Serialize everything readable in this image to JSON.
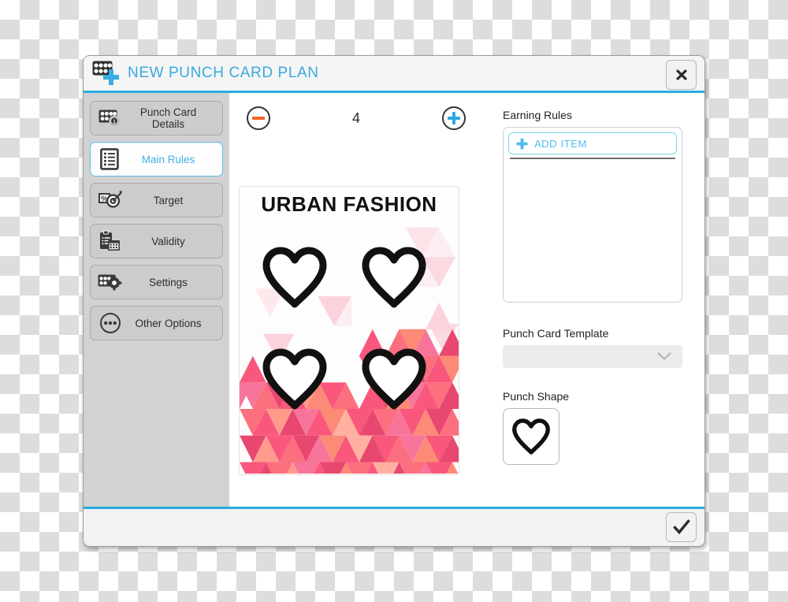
{
  "window": {
    "title": "NEW PUNCH CARD PLAN",
    "title_icon": "punch-card-plus-icon",
    "close_icon": "close-icon",
    "accent_color": "#29abe2"
  },
  "sidebar": {
    "items": [
      {
        "label": "Punch Card Details",
        "icon": "punch-card-info-icon",
        "active": false
      },
      {
        "label": "Main Rules",
        "icon": "list-document-icon",
        "active": true
      },
      {
        "label": "Target",
        "icon": "target-percent-icon",
        "active": false
      },
      {
        "label": "Validity",
        "icon": "clipboard-calendar-icon",
        "active": false
      },
      {
        "label": "Settings",
        "icon": "punch-card-gear-icon",
        "active": false
      },
      {
        "label": "Other Options",
        "icon": "ellipsis-circle-icon",
        "active": false
      }
    ]
  },
  "stepper": {
    "decrement_icon": "minus-circle-icon",
    "increment_icon": "plus-circle-icon",
    "value": "4",
    "minus_color": "#f26522",
    "plus_color": "#29abe2"
  },
  "card_preview": {
    "brand": "URBAN FASHION",
    "punch_count": 4,
    "punch_shape_icon": "heart-icon",
    "mosaic_colors": [
      "#f9577c",
      "#fb6f7f",
      "#fd8a76",
      "#e8486f",
      "#ff9a8c",
      "#f7759a",
      "#fc5e72",
      "#ffb0a0"
    ],
    "light_triangle_color": "#fde3e8"
  },
  "right_panel": {
    "earning_rules_label": "Earning Rules",
    "add_item_label": "ADD ITEM",
    "add_item_icon": "plus-icon",
    "template_label": "Punch Card Template",
    "template_value": "",
    "template_chevron_icon": "chevron-down-icon",
    "punch_shape_label": "Punch Shape",
    "punch_shape_icon": "heart-icon"
  },
  "footer": {
    "confirm_icon": "checkmark-icon"
  }
}
